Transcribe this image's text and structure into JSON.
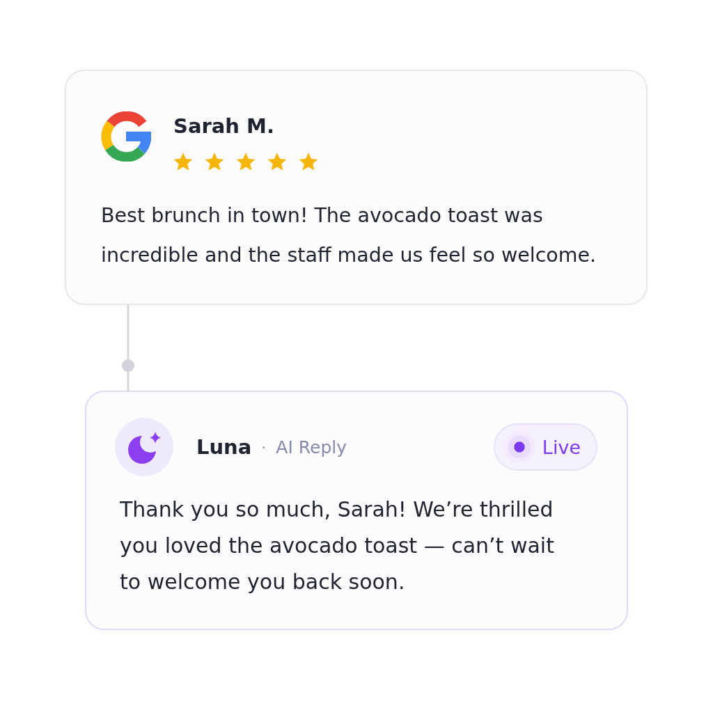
{
  "review": {
    "author": "Sarah M.",
    "stars": 5,
    "text": "Best brunch in town! The avocado toast was incredible and the staff made us feel so welcome."
  },
  "reply": {
    "author": "Luna",
    "separator": "·",
    "role": "AI Reply",
    "badge": {
      "label": "Live",
      "live": true
    },
    "text": "Thank you so much, Sarah! We’re thrilled you loved the avocado toast — can’t wait to welcome you back soon."
  }
}
